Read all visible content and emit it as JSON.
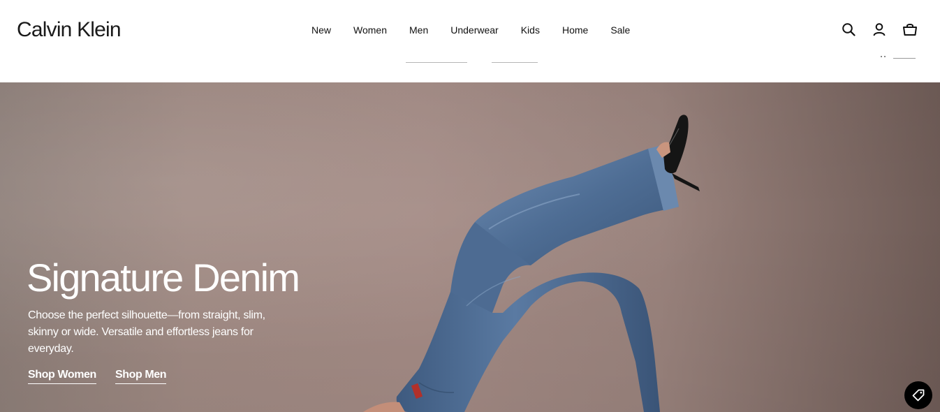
{
  "header": {
    "logo": "Calvin Klein",
    "nav": [
      {
        "label": "New"
      },
      {
        "label": "Women"
      },
      {
        "label": "Men"
      },
      {
        "label": "Underwear"
      },
      {
        "label": "Kids"
      },
      {
        "label": "Home"
      },
      {
        "label": "Sale"
      }
    ],
    "icons": [
      "search-icon",
      "account-icon",
      "shopping-bag-icon"
    ]
  },
  "hero": {
    "title": "Signature Denim",
    "description": "Choose the perfect silhouette—from straight, slim, skinny or wide. Versatile and effortless jeans for everyday.",
    "cta_women": "Shop Women",
    "cta_men": "Shop Men",
    "promo_icon": "tag-icon"
  },
  "colors": {
    "text": "#111111",
    "hero_bg": "#a08a83",
    "hero_text": "#ffffff",
    "denim": "#4f6f95"
  }
}
